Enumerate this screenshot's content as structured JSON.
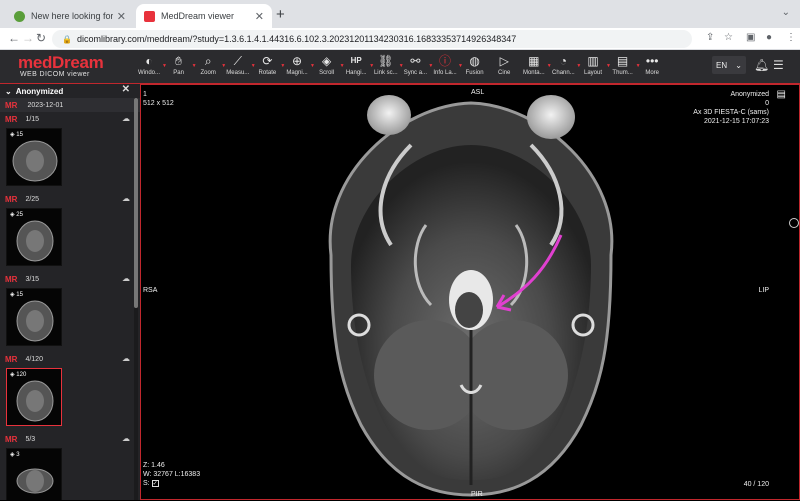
{
  "browser": {
    "tabs": [
      {
        "title": "New here looking for advice an",
        "active": false
      },
      {
        "title": "MedDream viewer",
        "active": true
      }
    ],
    "url": "dicomlibrary.com/meddream/?study=1.3.6.1.4.1.44316.6.102.3.20231201134230316.16833353714926348347"
  },
  "app": {
    "logo": "medDream",
    "logo_sub": "WEB DICOM viewer",
    "tools": [
      {
        "label": "Windo...",
        "icon": "window-level-icon"
      },
      {
        "label": "Pan",
        "icon": "hand-icon"
      },
      {
        "label": "Zoom",
        "icon": "zoom-icon"
      },
      {
        "label": "Measu...",
        "icon": "measure-icon"
      },
      {
        "label": "Rotate",
        "icon": "rotate-icon"
      },
      {
        "label": "Magni...",
        "icon": "magnify-icon"
      },
      {
        "label": "Scroll",
        "icon": "scroll-icon"
      },
      {
        "label": "Hangi...",
        "icon": "hanging-protocol-icon"
      },
      {
        "label": "Link sc...",
        "icon": "link-icon"
      },
      {
        "label": "Sync a...",
        "icon": "sync-icon"
      },
      {
        "label": "Info La...",
        "icon": "info-icon"
      },
      {
        "label": "Fusion",
        "icon": "fusion-icon"
      },
      {
        "label": "Cine",
        "icon": "cine-icon"
      },
      {
        "label": "Monta...",
        "icon": "montage-icon"
      },
      {
        "label": "Chann...",
        "icon": "channel-icon"
      },
      {
        "label": "Layout",
        "icon": "layout-icon"
      },
      {
        "label": "Thum...",
        "icon": "thumbnails-icon"
      },
      {
        "label": "More",
        "icon": "more-icon"
      }
    ],
    "hp_badge": "HP",
    "language": "EN"
  },
  "sidebar": {
    "patient": "Anonymized",
    "study": {
      "modality": "MR",
      "date": "2023-12-01"
    },
    "series": [
      {
        "modality": "MR",
        "label": "1/15",
        "count": "15"
      },
      {
        "modality": "MR",
        "label": "2/25",
        "count": "25"
      },
      {
        "modality": "MR",
        "label": "3/15",
        "count": "15"
      },
      {
        "modality": "MR",
        "label": "4/120",
        "count": "120"
      },
      {
        "modality": "MR",
        "label": "5/3",
        "count": "3"
      }
    ]
  },
  "viewer": {
    "top_left": [
      "1",
      "512 x 512"
    ],
    "top_center": "ASL",
    "top_right": [
      "Anonymized",
      "0",
      "Ax 3D FIESTA-C (sams)",
      "2021-12-15 17:07:23"
    ],
    "left": "RSA",
    "right": "LIP",
    "bottom_center": "PIR",
    "bottom_left": [
      "Z: 1.46",
      "W: 32767 L:16383",
      "S:"
    ],
    "bottom_right": "40 / 120",
    "annotation_color": "#e040d0"
  },
  "colors": {
    "accent": "#e8323c",
    "header_bg": "#2b2b2e",
    "sidebar_bg": "#242427"
  }
}
